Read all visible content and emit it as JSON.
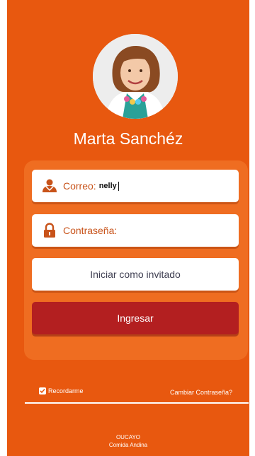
{
  "profile": {
    "name": "Marta Sanchéz",
    "avatar_icon": "user-photo"
  },
  "form": {
    "email_label": "Correo:",
    "email_value": "nelly",
    "email_icon": "person-icon",
    "password_label": "Contraseña:",
    "password_icon": "lock-icon",
    "guest_button": "Iniciar como invitado",
    "login_button": "Ingresar"
  },
  "options": {
    "remember_label": "Recordarme",
    "remember_checked": true,
    "change_password_link": "Cambiar Contraseña?"
  },
  "footer": {
    "brand": "OUCAYO",
    "tagline": "Comida Andina"
  },
  "colors": {
    "background": "#e8580f",
    "panel": "#ef6d21",
    "login_button": "#b31f20",
    "icon_accent": "#c8531a"
  }
}
